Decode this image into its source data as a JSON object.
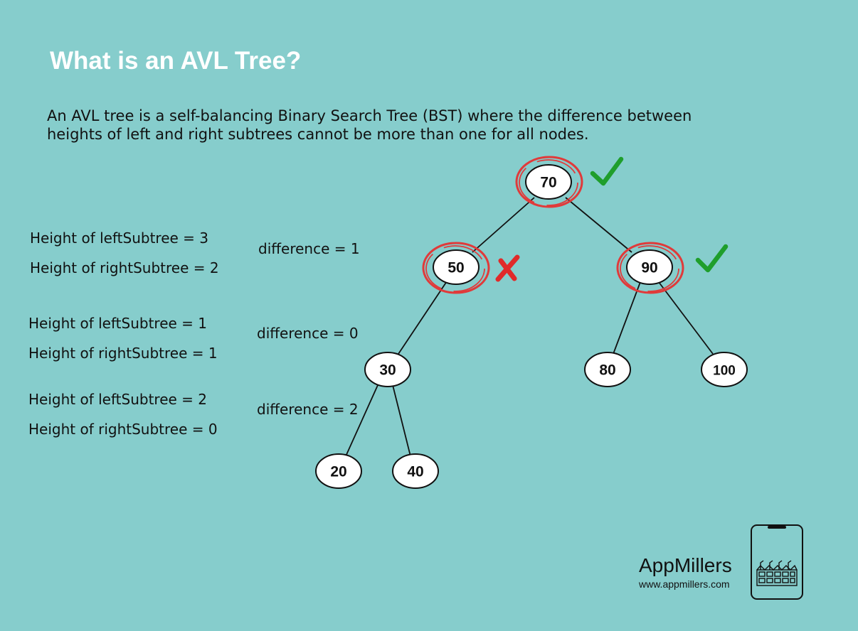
{
  "title": "What is an AVL Tree?",
  "description": {
    "line1": "An AVL tree is a self-balancing Binary Search Tree (BST) where the difference between",
    "line2": "heights of left and right subtrees cannot be more than one for all nodes."
  },
  "annotations": [
    {
      "left": "Height of leftSubtree = 3",
      "right": "Height of rightSubtree = 2",
      "difference": "difference = 1"
    },
    {
      "left": "Height of leftSubtree = 1",
      "right": "Height of rightSubtree = 1",
      "difference": "difference = 0"
    },
    {
      "left": "Height of leftSubtree = 2",
      "right": "Height of rightSubtree = 0",
      "difference": "difference = 2"
    }
  ],
  "nodes": {
    "n70": "70",
    "n50": "50",
    "n90": "90",
    "n30": "30",
    "n80": "80",
    "n100": "100",
    "n20": "20",
    "n40": "40"
  },
  "marks": {
    "n70": "check",
    "n50": "cross",
    "n90": "check"
  },
  "colors": {
    "background": "#86cdcc",
    "title": "#ffffff",
    "highlight_ring": "#e03a3a",
    "check": "#1f9e2c",
    "cross": "#e02a2a"
  },
  "brand": {
    "name": "AppMillers",
    "url": "www.appmillers.com",
    "logo_icon": "factory-phone-icon"
  }
}
